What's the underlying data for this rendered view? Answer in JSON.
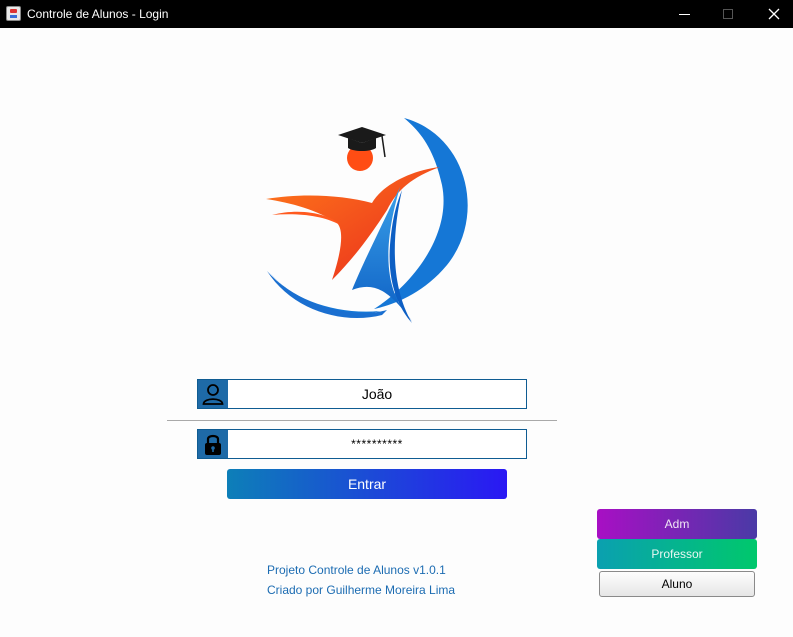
{
  "window": {
    "title": "Controle de Alunos - Login",
    "controls": [
      "minimize-icon",
      "maximize-icon",
      "close-icon"
    ]
  },
  "logo": {
    "description_icon": "graduate-figure-logo",
    "colors": {
      "orange": "#ff5a1f",
      "red": "#e8281e",
      "blue": "#1577d6",
      "light_blue": "#3aa0e8",
      "cap": "#1a1a1a"
    }
  },
  "login": {
    "username_value": "João",
    "username_icon": "user-icon",
    "password_value": "**********",
    "password_icon": "lock-icon",
    "submit_label": "Entrar"
  },
  "roles": {
    "adm_label": "Adm",
    "professor_label": "Professor",
    "aluno_label": "Aluno"
  },
  "footer": {
    "line1": "Projeto Controle de Alunos v1.0.1",
    "line2": "Criado por Guilherme Moreira Lima"
  },
  "colors": {
    "accent": "#1e6aa7",
    "link_text": "#1c6cb2"
  }
}
